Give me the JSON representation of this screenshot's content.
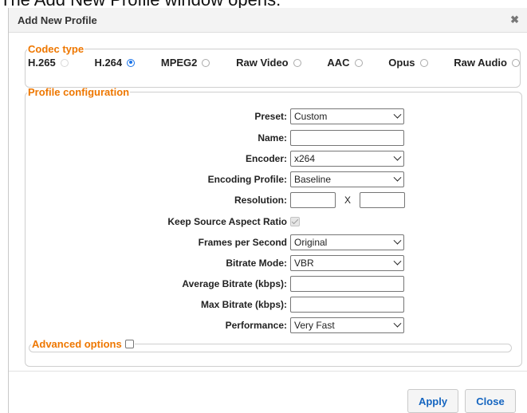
{
  "caption": "The Add New Profile window opens:",
  "dialog": {
    "title": "Add New Profile",
    "close_glyph": "✖"
  },
  "codec_type": {
    "legend": "Codec type",
    "options": [
      {
        "label": "H.265",
        "state": "disabled"
      },
      {
        "label": "H.264",
        "state": "checked"
      },
      {
        "label": "MPEG2",
        "state": "unchecked"
      },
      {
        "label": "Raw Video",
        "state": "unchecked"
      },
      {
        "label": "AAC",
        "state": "unchecked"
      },
      {
        "label": "Opus",
        "state": "unchecked"
      },
      {
        "label": "Raw Audio",
        "state": "unchecked"
      }
    ]
  },
  "profile": {
    "legend": "Profile configuration",
    "preset": {
      "label": "Preset:",
      "value": "Custom"
    },
    "name": {
      "label": "Name:",
      "value": ""
    },
    "encoder": {
      "label": "Encoder:",
      "value": "x264"
    },
    "encoding_profile": {
      "label": "Encoding Profile:",
      "value": "Baseline"
    },
    "resolution": {
      "label": "Resolution:",
      "separator": "X",
      "width": "",
      "height": ""
    },
    "keep_aspect": {
      "label": "Keep Source Aspect Ratio",
      "checked": true
    },
    "fps": {
      "label": "Frames per Second",
      "value": "Original"
    },
    "bitrate_mode": {
      "label": "Bitrate Mode:",
      "value": "VBR"
    },
    "avg_bitrate": {
      "label": "Average Bitrate (kbps):",
      "value": ""
    },
    "max_bitrate": {
      "label": "Max Bitrate (kbps):",
      "value": ""
    },
    "performance": {
      "label": "Performance:",
      "value": "Very Fast"
    }
  },
  "advanced": {
    "legend": "Advanced options",
    "checked": false
  },
  "buttons": {
    "apply": "Apply",
    "close": "Close"
  },
  "colors": {
    "legend_orange": "#ee7700",
    "button_blue": "#1565c0",
    "radio_blue": "#1a73e8"
  }
}
